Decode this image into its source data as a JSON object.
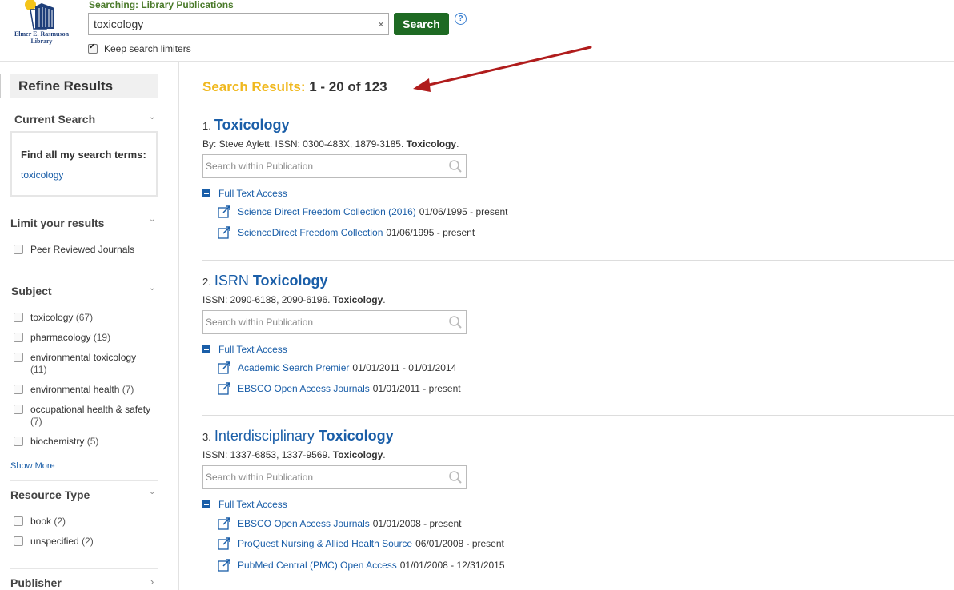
{
  "header": {
    "logo_line1": "Elmer E. Rasmuson",
    "logo_line2": "Library",
    "searching_label": "Searching: Library Publications",
    "query": "toxicology",
    "clear": "×",
    "search_button": "Search",
    "help": "?",
    "keep_limiters": "Keep search limiters"
  },
  "sidebar": {
    "refine_title": "Refine Results",
    "current_search": {
      "heading": "Current Search",
      "find_all": "Find all my search terms:",
      "term": "toxicology"
    },
    "limit": {
      "heading": "Limit your results",
      "items": [
        {
          "label": "Peer Reviewed Journals"
        }
      ]
    },
    "subject": {
      "heading": "Subject",
      "items": [
        {
          "label": "toxicology",
          "count": "(67)"
        },
        {
          "label": "pharmacology",
          "count": "(19)"
        },
        {
          "label": "environmental toxicology",
          "count": "(11)"
        },
        {
          "label": "environmental health",
          "count": "(7)"
        },
        {
          "label": "occupational health & safety",
          "count": "(7)"
        },
        {
          "label": "biochemistry",
          "count": "(5)"
        }
      ],
      "show_more": "Show More"
    },
    "resource_type": {
      "heading": "Resource Type",
      "items": [
        {
          "label": "book",
          "count": "(2)"
        },
        {
          "label": "unspecified",
          "count": "(2)"
        }
      ]
    },
    "publisher": {
      "heading": "Publisher"
    }
  },
  "results": {
    "label": "Search Results:",
    "range": "1 - 20 of 123",
    "search_within_placeholder": "Search within Publication",
    "full_text_access": "Full Text Access",
    "items": [
      {
        "num": "1.",
        "title_plain": "",
        "title_bold": "Toxicology",
        "meta_plain": "By: Steve Aylett. ISSN: 0300-483X, 1879-3185.",
        "meta_bold": "Toxicology",
        "links": [
          {
            "name": "Science Direct Freedom Collection (2016)",
            "dates": "01/06/1995 - present"
          },
          {
            "name": "ScienceDirect Freedom Collection",
            "dates": "01/06/1995 - present"
          }
        ]
      },
      {
        "num": "2.",
        "title_plain": "ISRN",
        "title_bold": "Toxicology",
        "meta_plain": "ISSN: 2090-6188, 2090-6196.",
        "meta_bold": "Toxicology",
        "links": [
          {
            "name": "Academic Search Premier",
            "dates": "01/01/2011 - 01/01/2014"
          },
          {
            "name": "EBSCO Open Access Journals",
            "dates": "01/01/2011 - present"
          }
        ]
      },
      {
        "num": "3.",
        "title_plain": "Interdisciplinary",
        "title_bold": "Toxicology",
        "meta_plain": "ISSN: 1337-6853, 1337-9569.",
        "meta_bold": "Toxicology",
        "links": [
          {
            "name": "EBSCO Open Access Journals",
            "dates": "01/01/2008 - present"
          },
          {
            "name": "ProQuest Nursing & Allied Health Source",
            "dates": "06/01/2008 - present"
          },
          {
            "name": "PubMed Central (PMC) Open Access",
            "dates": "01/01/2008 - 12/31/2015"
          }
        ]
      }
    ]
  },
  "colors": {
    "results_label": "#f0b81e",
    "search_button": "#1e6a23",
    "link": "#1a5ea8",
    "arrow": "#b01c1c"
  }
}
